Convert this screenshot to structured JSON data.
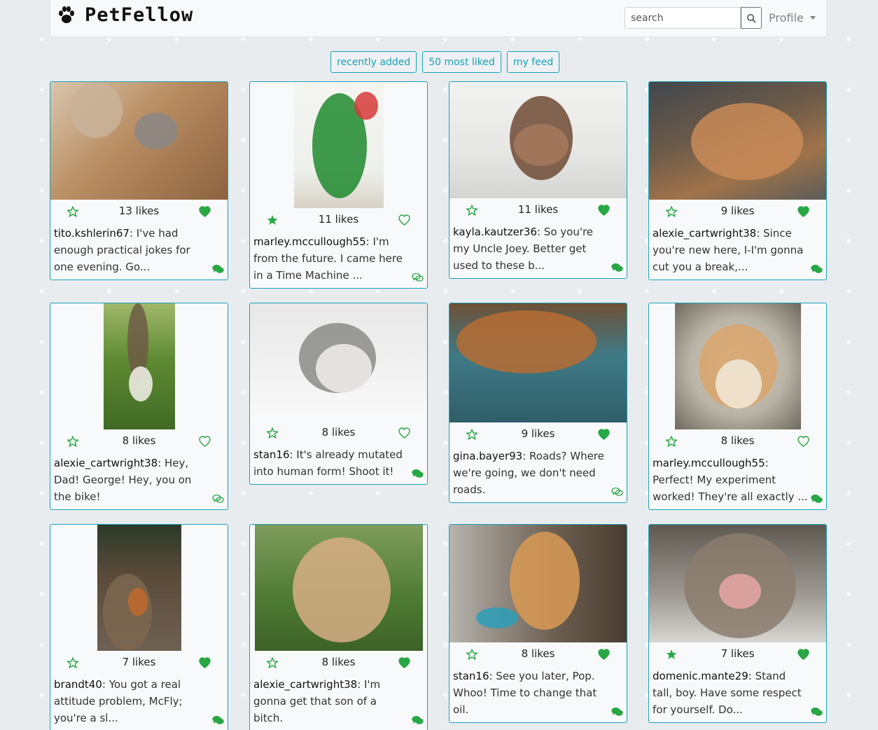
{
  "app": {
    "brand": "PetFellow",
    "search_placeholder": "search",
    "profile_label": "Profile"
  },
  "colors": {
    "accent": "#17a2b8",
    "like_green": "#28a745",
    "background": "#e9ecef"
  },
  "filters": [
    "recently added",
    "50 most liked",
    "my feed"
  ],
  "posts": [
    {
      "likes": "13 likes",
      "user": "tito.kshlerin67",
      "text": ": I've had enough practical jokes for one evening. Go...",
      "starred": false,
      "liked": true,
      "commented": true,
      "photo": "cat-box"
    },
    {
      "likes": "11 likes",
      "user": "marley.mccullough55",
      "text": ": I'm from the future. I came here in a Time Machine ...",
      "starred": true,
      "liked": false,
      "commented": false,
      "photo": "parrot"
    },
    {
      "likes": "11 likes",
      "user": "kayla.kautzer36",
      "text": ": So you're my Uncle Joey. Better get used to these b...",
      "starred": false,
      "liked": true,
      "commented": true,
      "photo": "puppy"
    },
    {
      "likes": "9 likes",
      "user": "alexie_cartwright38",
      "text": ": Since you're new here, I-I'm gonna cut you a break,...",
      "starred": false,
      "liked": true,
      "commented": true,
      "photo": "cat-lying"
    },
    {
      "likes": "8 likes",
      "user": "alexie_cartwright38",
      "text": ": Hey, Dad! George! Hey, you on the bike!",
      "starred": false,
      "liked": false,
      "commented": false,
      "photo": "dog-tree"
    },
    {
      "likes": "8 likes",
      "user": "stan16",
      "text": ": It's already mutated into human form! Shoot it!",
      "starred": false,
      "liked": false,
      "commented": true,
      "photo": "cat-white"
    },
    {
      "likes": "9 likes",
      "user": "gina.bayer93",
      "text": ": Roads? Where we're going, we don't need roads.",
      "starred": false,
      "liked": true,
      "commented": false,
      "photo": "dog-bench"
    },
    {
      "likes": "8 likes",
      "user": "marley.mccullough55",
      "text": ": Perfect! My experiment worked! They're all exactly ...",
      "starred": false,
      "liked": false,
      "commented": true,
      "photo": "hamster"
    },
    {
      "likes": "7 likes",
      "user": "brandt40",
      "text": ": You got a real attitude problem, McFly; you're a sl...",
      "starred": false,
      "liked": true,
      "commented": true,
      "photo": "dog-log"
    },
    {
      "likes": "8 likes",
      "user": "alexie_cartwright38",
      "text": ": I'm gonna get that son of a bitch.",
      "starred": false,
      "liked": true,
      "commented": true,
      "photo": "bunny"
    },
    {
      "likes": "8 likes",
      "user": "stan16",
      "text": ": See you later, Pop. Whoo! Time to change that oil.",
      "starred": false,
      "liked": true,
      "commented": true,
      "photo": "golden-puppy"
    },
    {
      "likes": "7 likes",
      "user": "domenic.mante29",
      "text": ": Stand tall, boy. Have some respect for yourself. Do...",
      "starred": true,
      "liked": true,
      "commented": true,
      "photo": "cat-yawn"
    }
  ]
}
